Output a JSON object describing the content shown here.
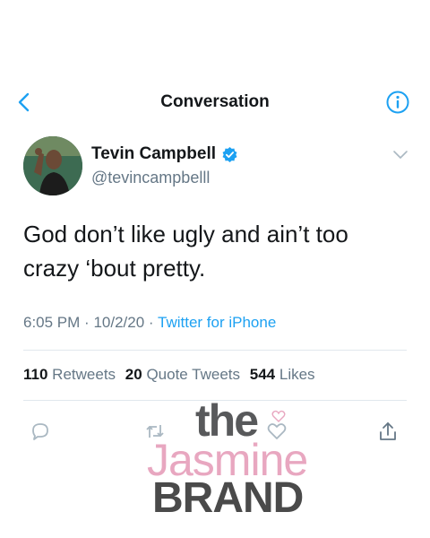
{
  "nav": {
    "title": "Conversation",
    "back_icon": "chevron-left-icon",
    "info_icon": "info-icon"
  },
  "tweet": {
    "display_name": "Tevin Campbell",
    "handle": "@tevincampbelll",
    "verified": true,
    "text": "God don’t like ugly and ain’t too crazy ‘bout pretty.",
    "time": "6:05 PM",
    "date": "10/2/20",
    "source": "Twitter for iPhone",
    "meta_separator": "·"
  },
  "stats": {
    "retweets_count": "110",
    "retweets_label": "Retweets",
    "quotes_count": "20",
    "quotes_label": "Quote Tweets",
    "likes_count": "544",
    "likes_label": "Likes"
  },
  "actions": [
    "reply-icon",
    "retweet-icon",
    "like-icon",
    "share-icon"
  ],
  "watermark": {
    "line1": "the",
    "line2": "Jasmine",
    "line3": "BRAND"
  },
  "colors": {
    "accent": "#1da1f2",
    "text": "#14171a",
    "muted": "#657786",
    "divider": "#e1e8ed",
    "watermark_pink": "#e8a7c0",
    "watermark_gray": "#58595b"
  }
}
